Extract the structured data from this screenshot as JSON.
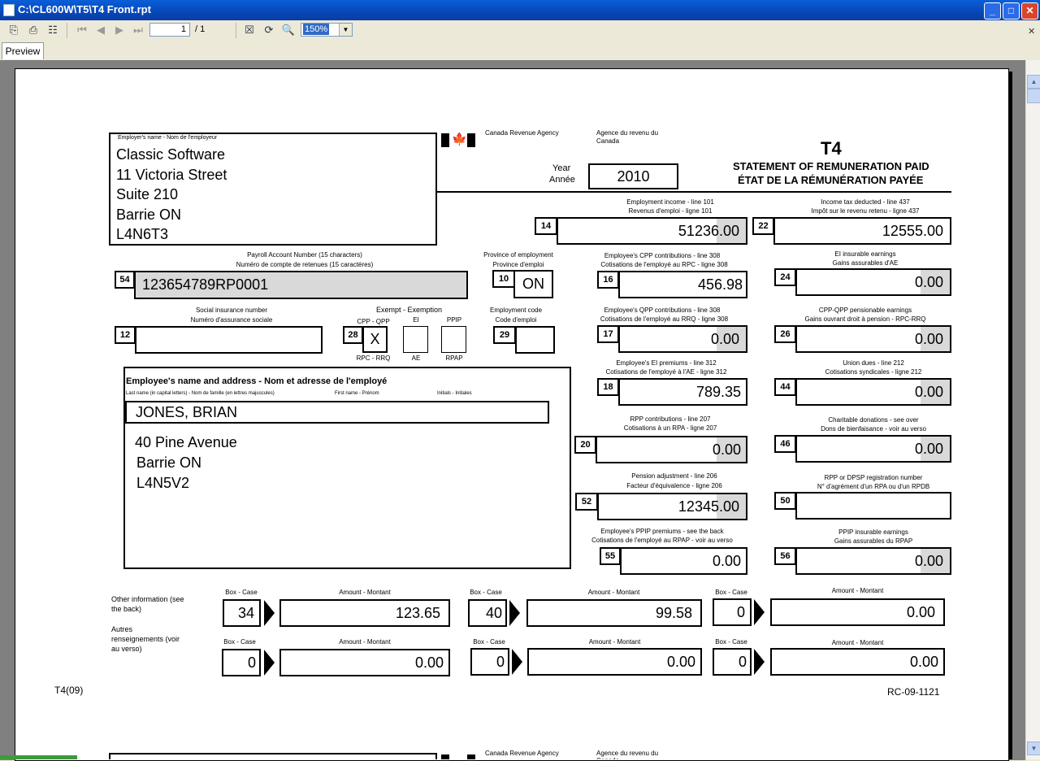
{
  "window": {
    "title": "C:\\CL600W\\T5\\T4 Front.rpt"
  },
  "toolbar": {
    "page_current": "1",
    "page_total": "/ 1",
    "zoom": "150%"
  },
  "tabs": [
    "Preview"
  ],
  "form": {
    "employer_label": "Employer's name - Nom de l'employeur",
    "employer_lines": [
      "Classic Software",
      "11 Victoria Street",
      "Suite 210",
      "Barrie  ON",
      "L4N6T3"
    ],
    "agency_en": "Canada Revenue Agency",
    "agency_fr": "Agence du revenu du Canada",
    "form_code": "T4",
    "title_en": "STATEMENT OF REMUNERATION PAID",
    "title_fr": "ÉTAT DE LA RÉMUNÉRATION PAYÉE",
    "year_label_en": "Year",
    "year_label_fr": "Année",
    "year": "2010",
    "payroll_label_en": "Payroll Account Number (15 characters)",
    "payroll_label_fr": "Numéro de compte de retenues (15 caractères)",
    "payroll_box": "54",
    "payroll_value": "123654789RP0001",
    "province_label_en": "Province of employment",
    "province_label_fr": "Province d'emploi",
    "province_box": "10",
    "province_value": "ON",
    "sin_label_en": "Social insurance number",
    "sin_label_fr": "Numéro d'assurance sociale",
    "sin_box": "12",
    "sin_value": "",
    "exempt_label": "Exempt - Exemption",
    "cpp_label": "CPP - QPP",
    "rpc_label": "RPC - RRQ",
    "ei_label": "EI",
    "ae_label": "AE",
    "ppip_label": "PPIP",
    "rpap_label": "RPAP",
    "exempt_box": "28",
    "exempt_cpp_value": "X",
    "emp_code_label_en": "Employment code",
    "emp_code_label_fr": "Code d'emploi",
    "emp_code_box": "29",
    "employee_label": "Employee's name and address - Nom et adresse de l'employé",
    "employee_sub_last": "Last name (in capital letters) - Nom de famille (en lettres majuscules)",
    "employee_sub_first": "First name - Prénom",
    "employee_sub_init": "Initials - Initiales",
    "employee_name": "JONES,  BRIAN",
    "employee_addr": [
      "40 Pine Avenue",
      "Barrie  ON",
      "L4N5V2"
    ],
    "left_boxes": [
      {
        "box": "14",
        "en": "Employment income - line 101",
        "fr": "Revenus d'emploi - ligne 101",
        "value": "51236.00"
      },
      {
        "box": "16",
        "en": "Employee's CPP contributions - line 308",
        "fr": "Cotisations de l'employé au RPC - ligne 308",
        "value": "456.98"
      },
      {
        "box": "17",
        "en": "Employee's QPP contributions - line 308",
        "fr": "Cotisations de l'employé au RRQ - ligne 308",
        "value": "0.00"
      },
      {
        "box": "18",
        "en": "Employee's EI premiums - line 312",
        "fr": "Cotisations de l'employé à l'AE - ligne 312",
        "value": "789.35"
      },
      {
        "box": "20",
        "en": "RPP contributions - line 207",
        "fr": "Cotisations à un RPA - ligne 207",
        "value": "0.00"
      },
      {
        "box": "52",
        "en": "Pension adjustment - line 206",
        "fr": "Facteur d'équivalence - ligne 206",
        "value": "12345.00"
      },
      {
        "box": "55",
        "en": "Employee's PPIP premiums - see the back",
        "fr": "Cotisations de l'employé au RPAP - voir au verso",
        "value": "0.00"
      }
    ],
    "right_boxes": [
      {
        "box": "22",
        "en": "Income tax deducted - line 437",
        "fr": "Impôt sur le revenu retenu - ligne 437",
        "value": "12555.00"
      },
      {
        "box": "24",
        "en": "EI insurable earnings",
        "fr": "Gains assurables d'AE",
        "value": "0.00"
      },
      {
        "box": "26",
        "en": "CPP-QPP pensionable earnings",
        "fr": "Gains ouvrant droit à pension - RPC-RRQ",
        "value": "0.00"
      },
      {
        "box": "44",
        "en": "Union dues - line 212",
        "fr": "Cotisations syndicales - ligne 212",
        "value": "0.00"
      },
      {
        "box": "46",
        "en": "Charitable donations - see over",
        "fr": "Dons de bienfaisance - voir au verso",
        "value": "0.00"
      },
      {
        "box": "50",
        "en": "RPP or DPSP registration number",
        "fr": "N° d'agrément d'un RPA ou d'un RPDB",
        "value": ""
      },
      {
        "box": "56",
        "en": "PPIP insurable earnings",
        "fr": "Gains assurables du RPAP",
        "value": "0.00"
      }
    ],
    "other_info_en": "Other information (see the back)",
    "other_info_fr": "Autres renseignements (voir au verso)",
    "box_case_label": "Box - Case",
    "amount_label": "Amount - Montant",
    "other_rows": [
      [
        {
          "box": "34",
          "amount": "123.65"
        },
        {
          "box": "40",
          "amount": "99.58"
        },
        {
          "box": "0",
          "amount": "0.00"
        }
      ],
      [
        {
          "box": "0",
          "amount": "0.00"
        },
        {
          "box": "0",
          "amount": "0.00"
        },
        {
          "box": "0",
          "amount": "0.00"
        }
      ]
    ],
    "footer_left": "T4(09)",
    "footer_right": "RC-09-1121"
  }
}
